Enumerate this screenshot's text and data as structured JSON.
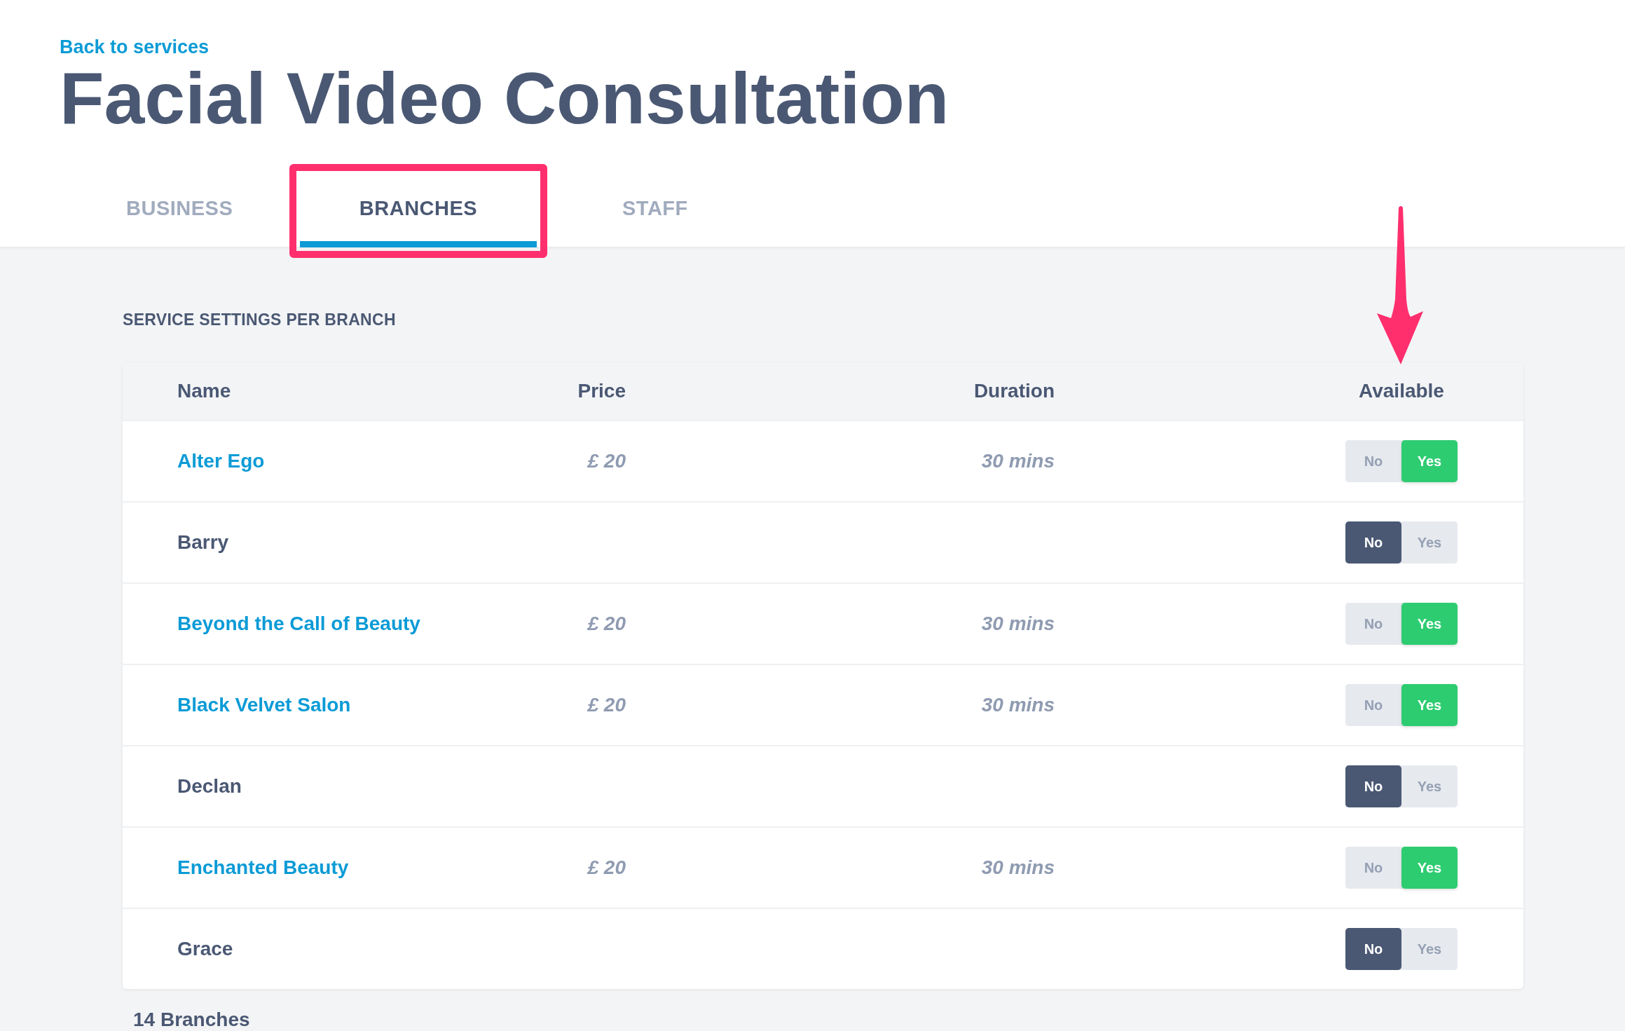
{
  "back_link": "Back to services",
  "title": "Facial Video Consultation",
  "tabs": [
    {
      "label": "BUSINESS",
      "selected": false
    },
    {
      "label": "BRANCHES",
      "selected": true
    },
    {
      "label": "STAFF",
      "selected": false
    }
  ],
  "section_title": "SERVICE SETTINGS PER BRANCH",
  "table": {
    "columns": [
      "Name",
      "Price",
      "Duration",
      "Available"
    ],
    "rows": [
      {
        "name": "Alter Ego",
        "link": true,
        "price": "£ 20",
        "duration": "30 mins",
        "options": [
          {
            "label": "No",
            "selected": false
          },
          {
            "label": "Yes",
            "selected": true
          }
        ]
      },
      {
        "name": "Barry",
        "link": false,
        "options": [
          {
            "label": "No",
            "selected": true
          },
          {
            "label": "Yes",
            "selected": false
          }
        ]
      },
      {
        "name": "Beyond the Call of Beauty",
        "link": true,
        "price": "£ 20",
        "duration": "30 mins",
        "options": [
          {
            "label": "No",
            "selected": false
          },
          {
            "label": "Yes",
            "selected": true
          }
        ]
      },
      {
        "name": "Black Velvet Salon",
        "link": true,
        "price": "£ 20",
        "duration": "30 mins",
        "options": [
          {
            "label": "No",
            "selected": false
          },
          {
            "label": "Yes",
            "selected": true
          }
        ]
      },
      {
        "name": "Declan",
        "link": false,
        "options": [
          {
            "label": "No",
            "selected": true
          },
          {
            "label": "Yes",
            "selected": false
          }
        ]
      },
      {
        "name": "Enchanted Beauty",
        "link": true,
        "price": "£ 20",
        "duration": "30 mins",
        "options": [
          {
            "label": "No",
            "selected": false
          },
          {
            "label": "Yes",
            "selected": true
          }
        ]
      },
      {
        "name": "Grace",
        "link": false,
        "options": [
          {
            "label": "No",
            "selected": true
          },
          {
            "label": "Yes",
            "selected": false
          }
        ]
      }
    ]
  },
  "footer": "14 Branches"
}
